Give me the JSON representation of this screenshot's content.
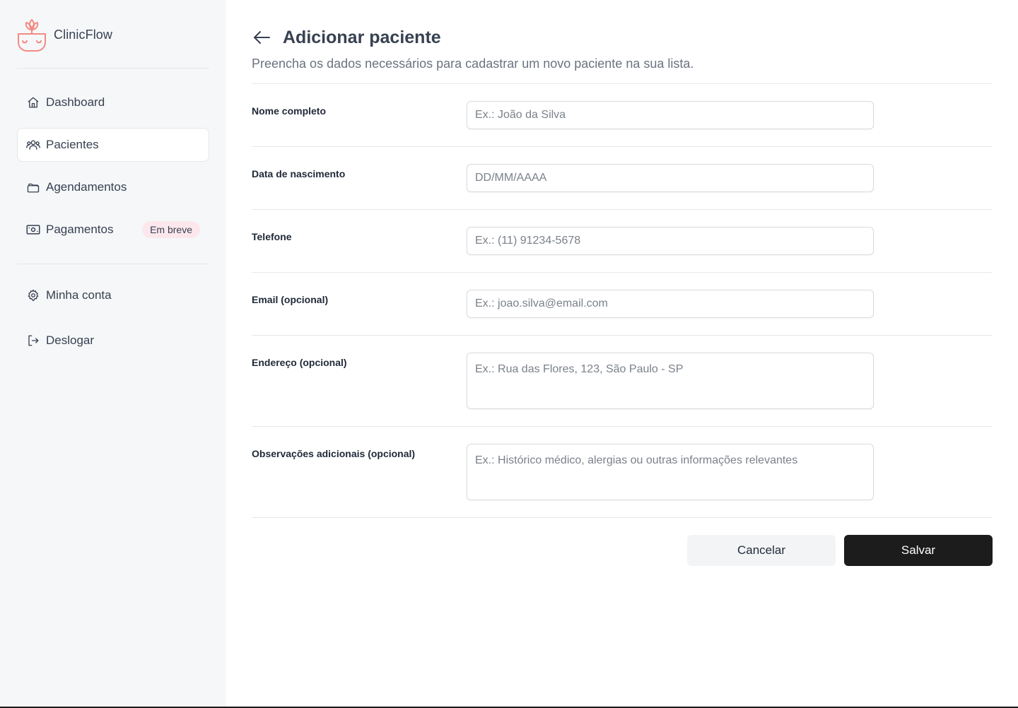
{
  "app": {
    "name": "ClinicFlow",
    "accent": "#f28b82"
  },
  "sidebar": {
    "items": [
      {
        "label": "Dashboard",
        "icon": "home-icon",
        "active": false
      },
      {
        "label": "Pacientes",
        "icon": "users-icon",
        "active": true
      },
      {
        "label": "Agendamentos",
        "icon": "folder-icon",
        "active": false
      },
      {
        "label": "Pagamentos",
        "icon": "banknote-icon",
        "active": false,
        "badge": "Em breve"
      }
    ],
    "secondary": [
      {
        "label": "Minha conta",
        "icon": "gear-icon"
      },
      {
        "label": "Deslogar",
        "icon": "logout-icon"
      }
    ]
  },
  "page": {
    "title": "Adicionar paciente",
    "subtitle": "Preencha os dados necessários para cadastrar um novo paciente na sua lista."
  },
  "form": {
    "name": {
      "label": "Nome completo",
      "placeholder": "Ex.: João da Silva",
      "value": ""
    },
    "birth": {
      "label": "Data de nascimento",
      "placeholder": "DD/MM/AAAA",
      "value": ""
    },
    "phone": {
      "label": "Telefone",
      "placeholder": "Ex.: (11) 91234-5678",
      "value": ""
    },
    "email": {
      "label": "Email (opcional)",
      "placeholder": "Ex.: joao.silva@email.com",
      "value": ""
    },
    "address": {
      "label": "Endereço (opcional)",
      "placeholder": "Ex.: Rua das Flores, 123, São Paulo - SP",
      "value": ""
    },
    "notes": {
      "label": "Observações adicionais (opcional)",
      "placeholder": "Ex.: Histórico médico, alergias ou outras informações relevantes",
      "value": ""
    }
  },
  "actions": {
    "cancel": "Cancelar",
    "save": "Salvar"
  }
}
